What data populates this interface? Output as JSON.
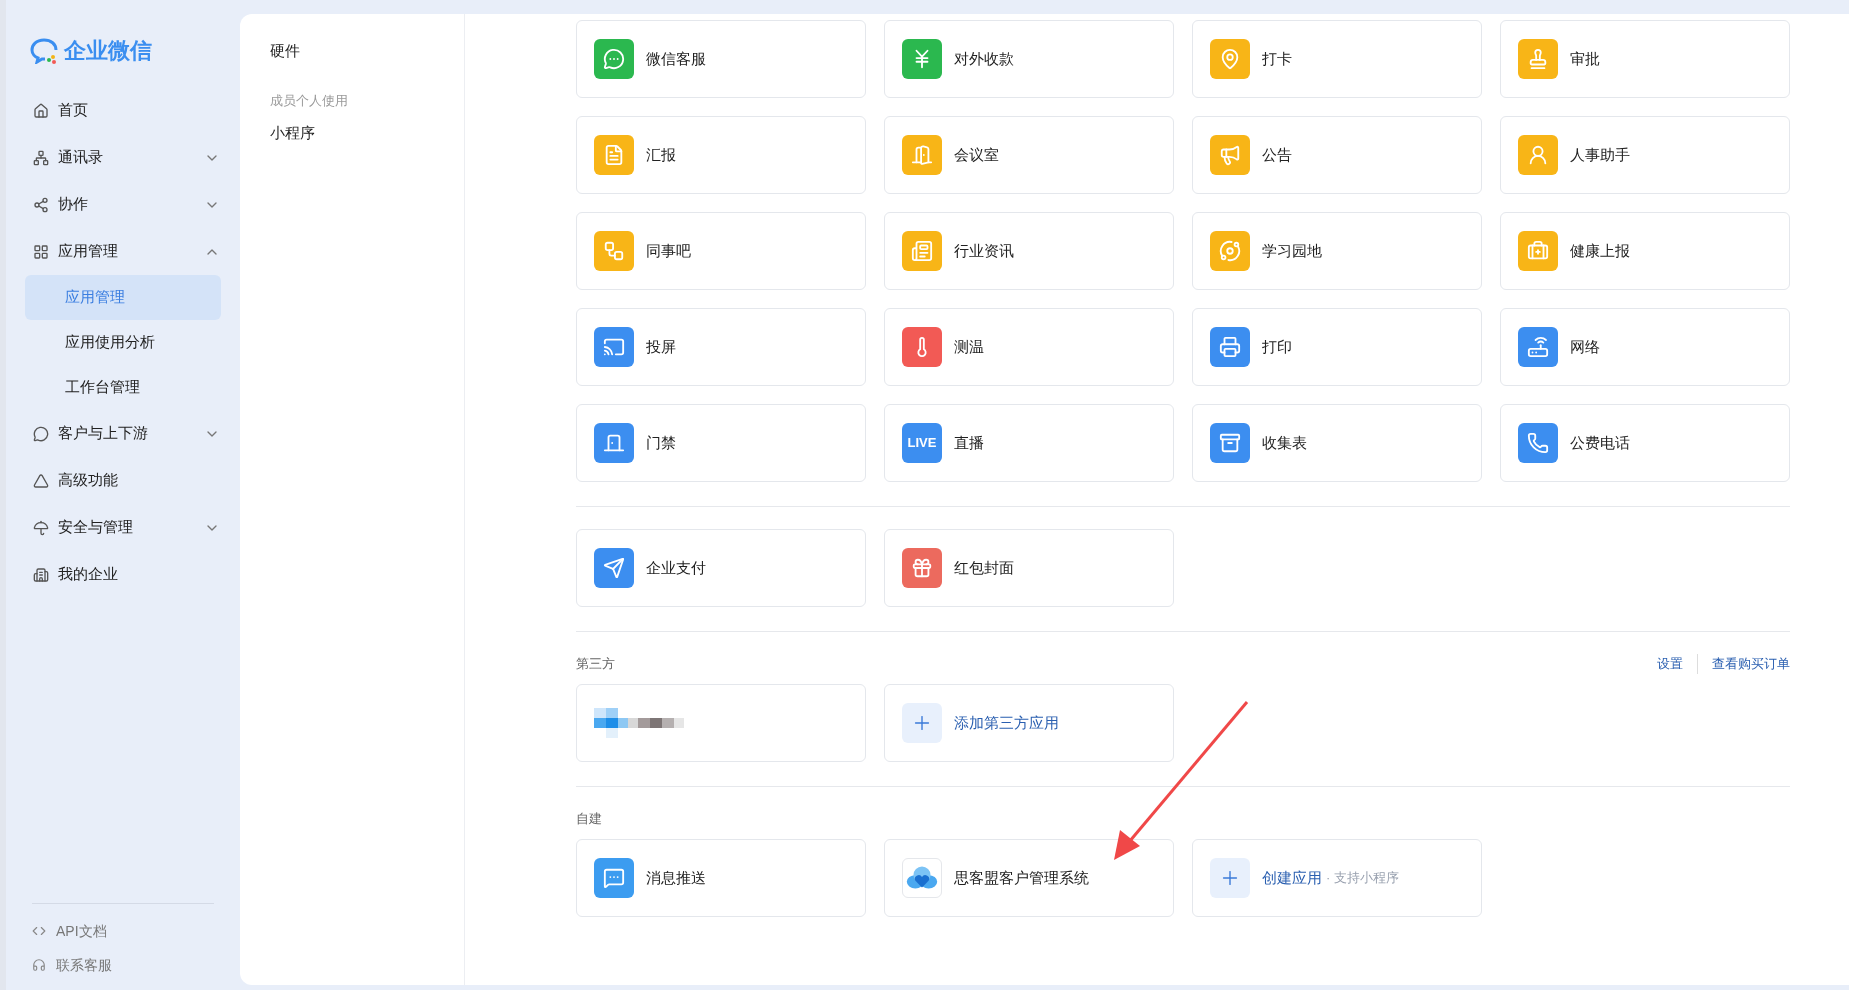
{
  "logo": {
    "text": "企业微信"
  },
  "nav": [
    {
      "kind": "link",
      "label": "首页"
    },
    {
      "kind": "group",
      "label": "通讯录",
      "expanded": false
    },
    {
      "kind": "group",
      "label": "协作",
      "expanded": false
    },
    {
      "kind": "group",
      "label": "应用管理",
      "expanded": true,
      "children": [
        {
          "label": "应用管理",
          "selected": true
        },
        {
          "label": "应用使用分析",
          "selected": false
        },
        {
          "label": "工作台管理",
          "selected": false
        }
      ]
    },
    {
      "kind": "group",
      "label": "客户与上下游",
      "expanded": false
    },
    {
      "kind": "link",
      "label": "高级功能"
    },
    {
      "kind": "group",
      "label": "安全与管理",
      "expanded": false
    },
    {
      "kind": "link",
      "label": "我的企业"
    }
  ],
  "footer_links": [
    "API文档",
    "联系客服"
  ],
  "categories": [
    {
      "kind": "link",
      "label": "硬件"
    },
    {
      "kind": "heading",
      "label": "成员个人使用"
    },
    {
      "kind": "link",
      "label": "小程序"
    }
  ],
  "sections": [
    {
      "apps": [
        {
          "kind": "app",
          "name": "微信客服",
          "color": "#2bb84f"
        },
        {
          "kind": "app",
          "name": "对外收款",
          "color": "#2bb84f"
        },
        {
          "kind": "app",
          "name": "打卡",
          "color": "#f8b517"
        },
        {
          "kind": "app",
          "name": "审批",
          "color": "#f8b517"
        },
        {
          "kind": "app",
          "name": "汇报",
          "color": "#f8b517"
        },
        {
          "kind": "app",
          "name": "会议室",
          "color": "#f8b517"
        },
        {
          "kind": "app",
          "name": "公告",
          "color": "#f8b517"
        },
        {
          "kind": "app",
          "name": "人事助手",
          "color": "#f8b517"
        },
        {
          "kind": "app",
          "name": "同事吧",
          "color": "#f8b517"
        },
        {
          "kind": "app",
          "name": "行业资讯",
          "color": "#f8b517"
        },
        {
          "kind": "app",
          "name": "学习园地",
          "color": "#f8b517"
        },
        {
          "kind": "app",
          "name": "健康上报",
          "color": "#f8b517"
        },
        {
          "kind": "app",
          "name": "投屏",
          "color": "#3c8ef0"
        },
        {
          "kind": "app",
          "name": "测温",
          "color": "#f25a55"
        },
        {
          "kind": "app",
          "name": "打印",
          "color": "#3c8ef0"
        },
        {
          "kind": "app",
          "name": "网络",
          "color": "#3c8ef0"
        },
        {
          "kind": "app",
          "name": "门禁",
          "color": "#3c8ef0"
        },
        {
          "kind": "app",
          "name": "直播",
          "color": "#3c8ef0",
          "icon_text": "LIVE"
        },
        {
          "kind": "app",
          "name": "收集表",
          "color": "#3c8ef0"
        },
        {
          "kind": "app",
          "name": "公费电话",
          "color": "#3c8ef0"
        }
      ]
    },
    {
      "apps": [
        {
          "kind": "app",
          "name": "企业支付",
          "color": "#3c8ef0"
        },
        {
          "kind": "app",
          "name": "红包封面",
          "color": "#ec6a5e"
        }
      ]
    },
    {
      "title": "第三方",
      "links": [
        "设置",
        "查看购买订单"
      ],
      "apps": [
        {
          "kind": "picture"
        },
        {
          "kind": "add",
          "name": "添加第三方应用"
        }
      ]
    },
    {
      "title": "自建",
      "apps": [
        {
          "kind": "app",
          "name": "消息推送",
          "color": "#3c9cf0"
        },
        {
          "kind": "app",
          "name": "思客盟客户管理系统"
        },
        {
          "kind": "add",
          "name": "创建应用",
          "note": "· 支持小程序"
        }
      ]
    }
  ]
}
